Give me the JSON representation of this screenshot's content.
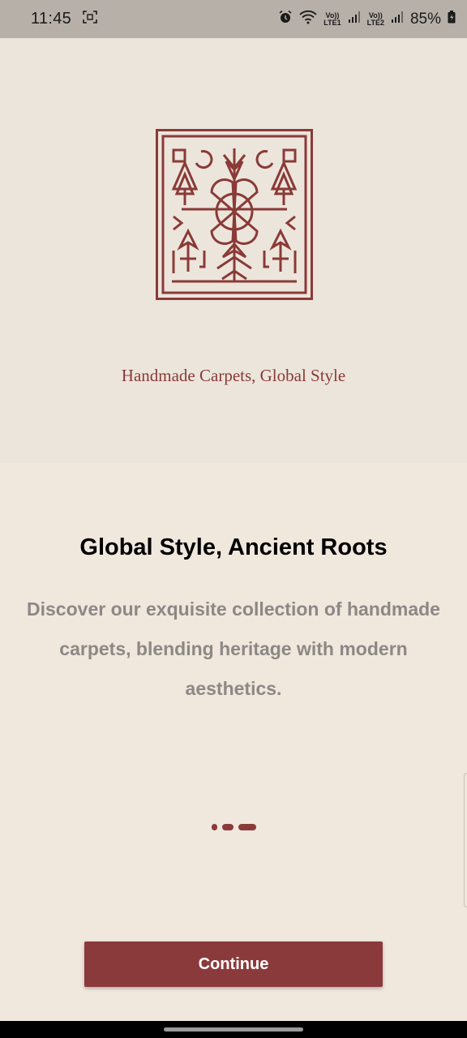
{
  "status_bar": {
    "time": "11:45",
    "sim1_label_top": "Vo))",
    "sim1_label_bottom": "LTE1",
    "sim2_label_top": "Vo))",
    "sim2_label_bottom": "LTE2",
    "battery": "85%",
    "icons": [
      "screenshot-icon",
      "alarm-icon",
      "wifi-icon",
      "signal-icon",
      "battery-icon"
    ]
  },
  "hero": {
    "logo": "carpet-pattern-logo",
    "tagline": "Handmade Carpets, Global Style"
  },
  "onboarding": {
    "headline": "Global Style, Ancient Roots",
    "description": "Discover our exquisite collection of handmade carpets, blending heritage with modern aesthetics.",
    "page_count": 3,
    "active_page": 3
  },
  "actions": {
    "continue_label": "Continue"
  },
  "colors": {
    "accent": "#8b3a3c",
    "background": "#f0e7dd",
    "hero_background": "#ece5dc",
    "status_bar": "#b7b0a9",
    "muted_text": "#8c8885"
  }
}
